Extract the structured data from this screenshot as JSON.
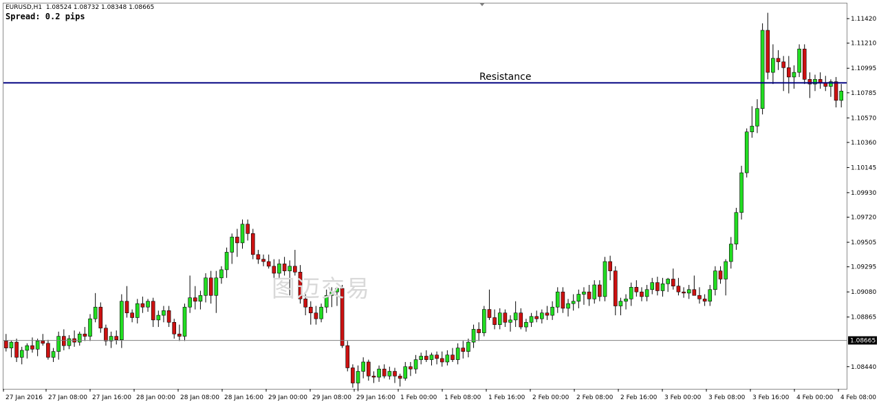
{
  "header": {
    "symbol_line": "EURUSD,H1  1.08524 1.08732 1.08348 1.08665",
    "spread_line": "Spread: 0.2 pips"
  },
  "watermark": "图迈交易",
  "colors": {
    "bull": "#22dd22",
    "bear": "#cc1111",
    "wick": "#000000",
    "resistance": "#000080",
    "bid_line": "#808080",
    "price_tag_bg": "#000000"
  },
  "chart_data": {
    "type": "candlestick",
    "symbol": "EURUSD",
    "timeframe": "H1",
    "ylim": [
      1.0825,
      1.1155
    ],
    "y_ticks": [
      "1.11420",
      "1.11210",
      "1.10995",
      "1.10785",
      "1.10570",
      "1.10360",
      "1.10145",
      "1.09930",
      "1.09720",
      "1.09505",
      "1.09295",
      "1.09080",
      "1.08865",
      "1.08440"
    ],
    "current_price": "1.08665",
    "resistance": {
      "label": "Resistance",
      "price": 1.1087
    },
    "x_labels": [
      "27 Jan 2016",
      "27 Jan 08:00",
      "27 Jan 16:00",
      "28 Jan 00:00",
      "28 Jan 08:00",
      "28 Jan 16:00",
      "29 Jan 00:00",
      "29 Jan 08:00",
      "29 Jan 16:00",
      "1 Feb 00:00",
      "1 Feb 08:00",
      "1 Feb 16:00",
      "2 Feb 00:00",
      "2 Feb 08:00",
      "2 Feb 16:00",
      "3 Feb 00:00",
      "3 Feb 08:00",
      "3 Feb 16:00",
      "4 Feb 00:00",
      "4 Feb 08:00"
    ],
    "candles": [
      [
        1.0866,
        1.0872,
        1.0857,
        1.086
      ],
      [
        1.086,
        1.0866,
        1.0852,
        1.0865
      ],
      [
        1.0865,
        1.0868,
        1.0848,
        1.0852
      ],
      [
        1.0852,
        1.0861,
        1.0846,
        1.0858
      ],
      [
        1.0858,
        1.0864,
        1.0851,
        1.0862
      ],
      [
        1.0862,
        1.0869,
        1.0856,
        1.0859
      ],
      [
        1.0859,
        1.0868,
        1.0853,
        1.0866
      ],
      [
        1.0866,
        1.0872,
        1.0862,
        1.0864
      ],
      [
        1.0864,
        1.0867,
        1.085,
        1.0852
      ],
      [
        1.0852,
        1.086,
        1.0848,
        1.0857
      ],
      [
        1.0857,
        1.0874,
        1.085,
        1.087
      ],
      [
        1.087,
        1.0876,
        1.0858,
        1.0862
      ],
      [
        1.0862,
        1.0871,
        1.0859,
        1.0868
      ],
      [
        1.0868,
        1.0875,
        1.0861,
        1.0865
      ],
      [
        1.0865,
        1.0874,
        1.0862,
        1.0872
      ],
      [
        1.0872,
        1.0878,
        1.0866,
        1.087
      ],
      [
        1.087,
        1.0889,
        1.0866,
        1.0885
      ],
      [
        1.0885,
        1.0907,
        1.0882,
        1.0895
      ],
      [
        1.0895,
        1.0899,
        1.0873,
        1.0877
      ],
      [
        1.0877,
        1.088,
        1.0862,
        1.0866
      ],
      [
        1.0866,
        1.0874,
        1.086,
        1.087
      ],
      [
        1.087,
        1.0875,
        1.0863,
        1.0867
      ],
      [
        1.0867,
        1.0906,
        1.086,
        1.09
      ],
      [
        1.09,
        1.0913,
        1.0886,
        1.089
      ],
      [
        1.089,
        1.0893,
        1.0882,
        1.0886
      ],
      [
        1.0886,
        1.0902,
        1.0881,
        1.0898
      ],
      [
        1.0898,
        1.0904,
        1.089,
        1.0895
      ],
      [
        1.0895,
        1.0902,
        1.0891,
        1.09
      ],
      [
        1.09,
        1.0903,
        1.0878,
        1.0884
      ],
      [
        1.0884,
        1.0892,
        1.0878,
        1.0888
      ],
      [
        1.0888,
        1.0896,
        1.0882,
        1.0892
      ],
      [
        1.0892,
        1.0896,
        1.0878,
        1.0882
      ],
      [
        1.0882,
        1.0885,
        1.0868,
        1.0872
      ],
      [
        1.0872,
        1.088,
        1.0866,
        1.087
      ],
      [
        1.087,
        1.0898,
        1.0866,
        1.0895
      ],
      [
        1.0895,
        1.0922,
        1.089,
        1.0903
      ],
      [
        1.0903,
        1.0913,
        1.0893,
        1.09
      ],
      [
        1.09,
        1.0909,
        1.0893,
        1.0905
      ],
      [
        1.0905,
        1.0924,
        1.0899,
        1.092
      ],
      [
        1.092,
        1.0926,
        1.0898,
        1.0905
      ],
      [
        1.0905,
        1.0926,
        1.089,
        1.092
      ],
      [
        1.092,
        1.093,
        1.0915,
        1.0927
      ],
      [
        1.0927,
        1.0946,
        1.092,
        1.0942
      ],
      [
        1.0942,
        1.0958,
        1.0932,
        1.0955
      ],
      [
        1.0955,
        1.0962,
        1.0938,
        1.095
      ],
      [
        1.095,
        1.097,
        1.0945,
        1.0966
      ],
      [
        1.0966,
        1.097,
        1.0952,
        1.0958
      ],
      [
        1.0958,
        1.0962,
        1.0936,
        1.094
      ],
      [
        1.094,
        1.0944,
        1.0932,
        1.0936
      ],
      [
        1.0936,
        1.094,
        1.093,
        1.0934
      ],
      [
        1.0934,
        1.094,
        1.0928,
        1.093
      ],
      [
        1.093,
        1.0936,
        1.092,
        1.0924
      ],
      [
        1.0924,
        1.0936,
        1.092,
        1.0932
      ],
      [
        1.0932,
        1.0938,
        1.0922,
        1.0926
      ],
      [
        1.0926,
        1.0935,
        1.0905,
        1.093
      ],
      [
        1.093,
        1.0944,
        1.0922,
        1.0925
      ],
      [
        1.0925,
        1.0931,
        1.0898,
        1.0902
      ],
      [
        1.0902,
        1.0906,
        1.0888,
        1.0895
      ],
      [
        1.0895,
        1.09,
        1.088,
        1.089
      ],
      [
        1.089,
        1.0896,
        1.088,
        1.0885
      ],
      [
        1.0885,
        1.0898,
        1.0882,
        1.0895
      ],
      [
        1.0895,
        1.091,
        1.089,
        1.0905
      ],
      [
        1.0905,
        1.0912,
        1.0895,
        1.0908
      ],
      [
        1.0908,
        1.0912,
        1.0896,
        1.0911
      ],
      [
        1.0911,
        1.0914,
        1.086,
        1.0862
      ],
      [
        1.0862,
        1.0866,
        1.084,
        1.0843
      ],
      [
        1.0843,
        1.0846,
        1.0826,
        1.083
      ],
      [
        1.083,
        1.0845,
        1.0823,
        1.084
      ],
      [
        1.084,
        1.0852,
        1.0834,
        1.0848
      ],
      [
        1.0848,
        1.085,
        1.0832,
        1.0836
      ],
      [
        1.0836,
        1.084,
        1.083,
        1.0835
      ],
      [
        1.0835,
        1.0845,
        1.0831,
        1.0842
      ],
      [
        1.0842,
        1.0846,
        1.0834,
        1.0836
      ],
      [
        1.0836,
        1.0844,
        1.0833,
        1.084
      ],
      [
        1.084,
        1.0843,
        1.083,
        1.0836
      ],
      [
        1.0836,
        1.0838,
        1.0827,
        1.0834
      ],
      [
        1.0834,
        1.0848,
        1.0832,
        1.0844
      ],
      [
        1.0844,
        1.0848,
        1.0836,
        1.0842
      ],
      [
        1.0842,
        1.0854,
        1.0838,
        1.085
      ],
      [
        1.085,
        1.0856,
        1.0846,
        1.0853
      ],
      [
        1.0853,
        1.0858,
        1.0848,
        1.085
      ],
      [
        1.085,
        1.0856,
        1.0845,
        1.0854
      ],
      [
        1.0854,
        1.0857,
        1.0846,
        1.0851
      ],
      [
        1.0851,
        1.0857,
        1.0844,
        1.0848
      ],
      [
        1.0848,
        1.0858,
        1.0845,
        1.0854
      ],
      [
        1.0854,
        1.086,
        1.0848,
        1.085
      ],
      [
        1.085,
        1.0864,
        1.0846,
        1.086
      ],
      [
        1.086,
        1.0866,
        1.0851,
        1.0857
      ],
      [
        1.0857,
        1.0868,
        1.0852,
        1.0865
      ],
      [
        1.0865,
        1.088,
        1.086,
        1.0876
      ],
      [
        1.0876,
        1.0882,
        1.0866,
        1.0873
      ],
      [
        1.0873,
        1.0896,
        1.087,
        1.0893
      ],
      [
        1.0893,
        1.091,
        1.0884,
        1.0886
      ],
      [
        1.0886,
        1.0893,
        1.0876,
        1.088
      ],
      [
        1.088,
        1.0894,
        1.0876,
        1.089
      ],
      [
        1.089,
        1.0893,
        1.0878,
        1.0882
      ],
      [
        1.0882,
        1.0888,
        1.0874,
        1.0884
      ],
      [
        1.0884,
        1.09,
        1.0878,
        1.089
      ],
      [
        1.089,
        1.0894,
        1.0876,
        1.0878
      ],
      [
        1.0878,
        1.0885,
        1.0874,
        1.0882
      ],
      [
        1.0882,
        1.089,
        1.0878,
        1.0887
      ],
      [
        1.0887,
        1.0892,
        1.0882,
        1.0885
      ],
      [
        1.0885,
        1.0893,
        1.0881,
        1.089
      ],
      [
        1.089,
        1.0896,
        1.0884,
        1.0888
      ],
      [
        1.0888,
        1.09,
        1.0884,
        1.0895
      ],
      [
        1.0895,
        1.0912,
        1.089,
        1.0908
      ],
      [
        1.0908,
        1.0912,
        1.089,
        1.0894
      ],
      [
        1.0894,
        1.0902,
        1.0887,
        1.0898
      ],
      [
        1.0898,
        1.0906,
        1.0892,
        1.09
      ],
      [
        1.09,
        1.091,
        1.0894,
        1.0906
      ],
      [
        1.0906,
        1.0912,
        1.0897,
        1.0908
      ],
      [
        1.0908,
        1.0914,
        1.0896,
        1.0902
      ],
      [
        1.0902,
        1.0918,
        1.0898,
        1.0914
      ],
      [
        1.0914,
        1.0918,
        1.09,
        1.0904
      ],
      [
        1.0904,
        1.0938,
        1.09,
        1.0934
      ],
      [
        1.0934,
        1.0939,
        1.0918,
        1.0926
      ],
      [
        1.0926,
        1.093,
        1.0888,
        1.0896
      ],
      [
        1.0896,
        1.0903,
        1.0888,
        1.09
      ],
      [
        1.09,
        1.0906,
        1.0893,
        1.0902
      ],
      [
        1.0902,
        1.0916,
        1.0896,
        1.0912
      ],
      [
        1.0912,
        1.0918,
        1.0904,
        1.0908
      ],
      [
        1.0908,
        1.0912,
        1.09,
        1.0904
      ],
      [
        1.0904,
        1.0914,
        1.09,
        1.091
      ],
      [
        1.091,
        1.092,
        1.0906,
        1.0916
      ],
      [
        1.0916,
        1.0921,
        1.0905,
        1.0909
      ],
      [
        1.0909,
        1.092,
        1.0904,
        1.0915
      ],
      [
        1.0915,
        1.092,
        1.0908,
        1.0919
      ],
      [
        1.0919,
        1.0928,
        1.091,
        1.0913
      ],
      [
        1.0913,
        1.092,
        1.0905,
        1.0908
      ],
      [
        1.0908,
        1.0912,
        1.0903,
        1.0907
      ],
      [
        1.0907,
        1.0914,
        1.0902,
        1.091
      ],
      [
        1.091,
        1.0922,
        1.0905,
        1.0905
      ],
      [
        1.0905,
        1.0912,
        1.0898,
        1.0902
      ],
      [
        1.0902,
        1.0906,
        1.0896,
        1.09
      ],
      [
        1.09,
        1.0914,
        1.0896,
        1.091
      ],
      [
        1.091,
        1.093,
        1.0905,
        1.0926
      ],
      [
        1.0926,
        1.093,
        1.0915,
        1.0919
      ],
      [
        1.0919,
        1.0936,
        1.0905,
        1.0934
      ],
      [
        1.0934,
        1.0955,
        1.0928,
        1.0949
      ],
      [
        1.0949,
        1.098,
        1.0944,
        1.0976
      ],
      [
        1.0976,
        1.1016,
        1.097,
        1.101
      ],
      [
        1.101,
        1.1048,
        1.1006,
        1.1045
      ],
      [
        1.1045,
        1.1067,
        1.104,
        1.105
      ],
      [
        1.105,
        1.1073,
        1.1044,
        1.1065
      ],
      [
        1.1065,
        1.1138,
        1.106,
        1.1132
      ],
      [
        1.1132,
        1.1147,
        1.109,
        1.1096
      ],
      [
        1.1096,
        1.112,
        1.1086,
        1.1108
      ],
      [
        1.1108,
        1.1115,
        1.1098,
        1.1105
      ],
      [
        1.1105,
        1.111,
        1.108,
        1.11
      ],
      [
        1.11,
        1.111,
        1.1078,
        1.1092
      ],
      [
        1.1092,
        1.1102,
        1.1082,
        1.1096
      ],
      [
        1.1096,
        1.112,
        1.1092,
        1.1116
      ],
      [
        1.1116,
        1.112,
        1.1086,
        1.109
      ],
      [
        1.109,
        1.1096,
        1.1074,
        1.1086
      ],
      [
        1.1086,
        1.1094,
        1.108,
        1.109
      ],
      [
        1.109,
        1.1096,
        1.1082,
        1.1087
      ],
      [
        1.1087,
        1.1093,
        1.108,
        1.1084
      ],
      [
        1.1084,
        1.109,
        1.1075,
        1.1088
      ],
      [
        1.1088,
        1.1092,
        1.1066,
        1.1072
      ],
      [
        1.1072,
        1.1086,
        1.1066,
        1.108
      ]
    ]
  }
}
